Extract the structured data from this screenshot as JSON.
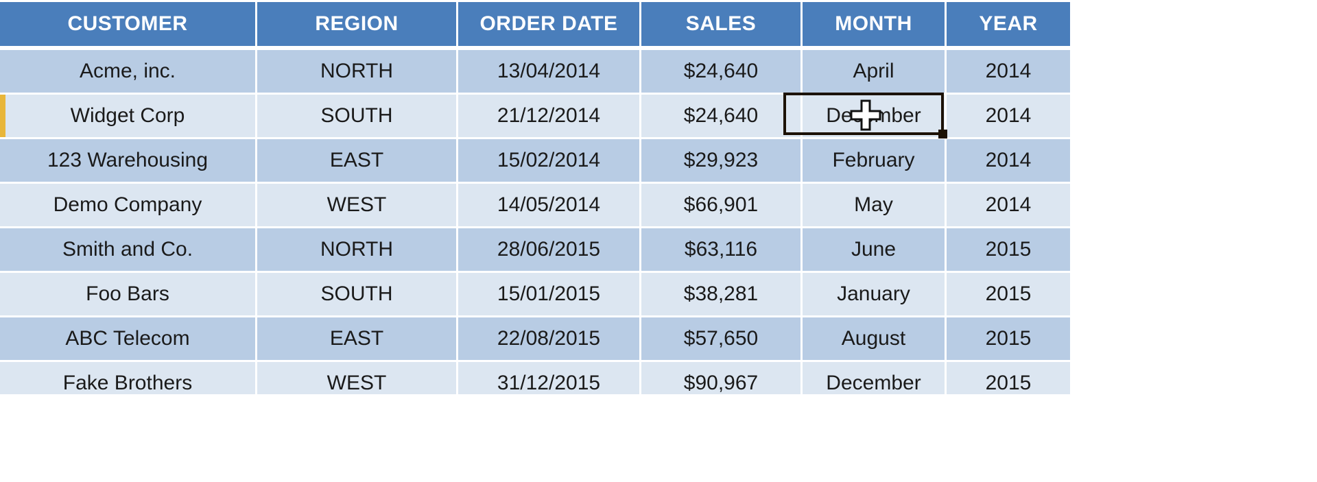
{
  "app": {
    "kind": "spreadsheet-data-table"
  },
  "theme": {
    "header_bg": "#4a7ebb",
    "header_text": "#ffffff",
    "band_dark": "#b8cce4",
    "band_light": "#dce6f1",
    "gridline": "#ffffff",
    "cell_text": "#1a1a1a",
    "selection_border": "#1c1205",
    "row_marker": "#e8b63a",
    "sheet_bg": "#ffffff"
  },
  "table": {
    "columns": [
      {
        "key": "customer",
        "label": "CUSTOMER",
        "align": "center"
      },
      {
        "key": "region",
        "label": "REGION",
        "align": "center"
      },
      {
        "key": "order_date",
        "label": "ORDER DATE",
        "align": "center"
      },
      {
        "key": "sales",
        "label": "SALES",
        "align": "center"
      },
      {
        "key": "month",
        "label": "MONTH",
        "align": "center"
      },
      {
        "key": "year",
        "label": "YEAR",
        "align": "center"
      }
    ],
    "rows": [
      {
        "customer": "Acme, inc.",
        "region": "NORTH",
        "order_date": "13/04/2014",
        "sales": "$24,640",
        "month": "April",
        "year": "2014"
      },
      {
        "customer": "Widget Corp",
        "region": "SOUTH",
        "order_date": "21/12/2014",
        "sales": "$24,640",
        "month": "December",
        "year": "2014"
      },
      {
        "customer": "123 Warehousing",
        "region": "EAST",
        "order_date": "15/02/2014",
        "sales": "$29,923",
        "month": "February",
        "year": "2014"
      },
      {
        "customer": "Demo Company",
        "region": "WEST",
        "order_date": "14/05/2014",
        "sales": "$66,901",
        "month": "May",
        "year": "2014"
      },
      {
        "customer": "Smith and Co.",
        "region": "NORTH",
        "order_date": "28/06/2015",
        "sales": "$63,116",
        "month": "June",
        "year": "2015"
      },
      {
        "customer": "Foo Bars",
        "region": "SOUTH",
        "order_date": "15/01/2015",
        "sales": "$38,281",
        "month": "January",
        "year": "2015"
      },
      {
        "customer": "ABC Telecom",
        "region": "EAST",
        "order_date": "22/08/2015",
        "sales": "$57,650",
        "month": "August",
        "year": "2015"
      },
      {
        "customer": "Fake Brothers",
        "region": "WEST",
        "order_date": "31/12/2015",
        "sales": "$90,967",
        "month": "December",
        "year": "2015"
      }
    ]
  },
  "selection": {
    "active_row_index": 1,
    "active_column_key": "sales",
    "active_cell_value": "$24,640",
    "has_fill_handle": true
  },
  "cursor": {
    "icon": "plus-crosshair-cursor",
    "over_row_index": 1,
    "over_column_key": "sales"
  }
}
